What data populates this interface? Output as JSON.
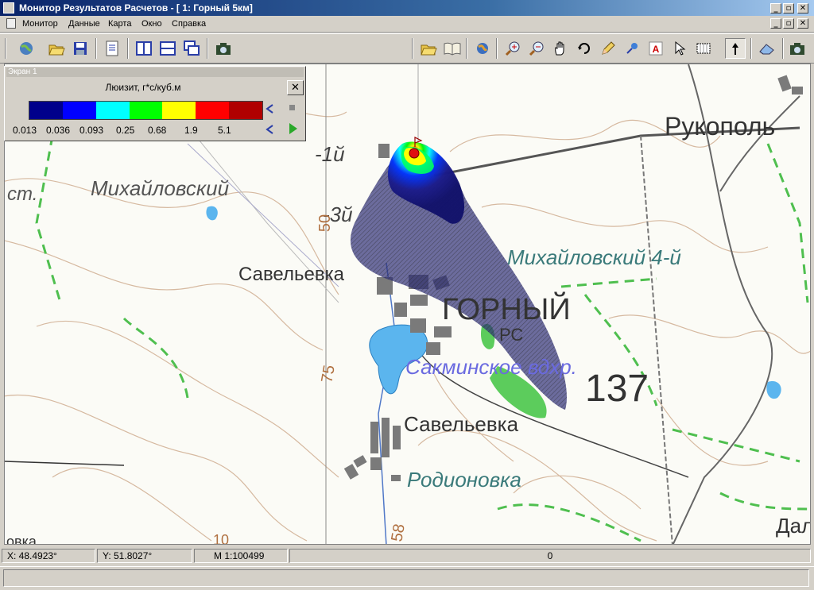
{
  "window": {
    "title": "Монитор Результатов Расчетов - [ 1: Горный 5км]"
  },
  "title_buttons": {
    "minimize": "_",
    "restore": "▫",
    "close": "✕"
  },
  "menu": {
    "items": [
      "Монитор",
      "Данные",
      "Карта",
      "Окно",
      "Справка"
    ]
  },
  "toolbar": {
    "left": [
      "globe-icon",
      "open-folder-icon",
      "save-disk-icon",
      "document-icon",
      "split-vertical-icon",
      "split-horizontal-icon",
      "cascade-windows-icon",
      "camera-icon"
    ],
    "right": [
      "open-map-icon",
      "book-icon",
      "globe-small-icon",
      "zoom-in-icon",
      "zoom-out-icon",
      "hand-pan-icon",
      "rotate-icon",
      "pencil-icon",
      "pin-icon",
      "text-tool-icon",
      "pointer-icon",
      "grid-select-icon",
      "north-arrow-icon",
      "eraser-icon",
      "camera-icon"
    ],
    "pressed": "north-arrow-icon"
  },
  "legend_panel": {
    "header": "Экран 1",
    "title": "Люизит, г*с/куб.м",
    "close": "✕",
    "colors": [
      "#00008b",
      "#0000ff",
      "#00ffff",
      "#00ff00",
      "#ffff00",
      "#ff0000",
      "#b00000"
    ],
    "values": [
      "0.013",
      "0.036",
      "0.093",
      "0.25",
      "0.68",
      "1.9",
      "5.1"
    ]
  },
  "map": {
    "labels": {
      "mikhailovsky": "Михайловский",
      "st": "ст.",
      "first": "-1й",
      "third": "-3й",
      "fifty": "50",
      "rukopol": "Рукополь",
      "savelevka_top": "Савельевка",
      "mikhailovsky4": "Михайловский 4-й",
      "gorny": "ГОРНЫЙ",
      "pc": "РС",
      "reservoir": "Сакминское вдхр.",
      "num137": "137",
      "num75": "75",
      "savelevka_bottom": "Савельевка",
      "rodionovka": "Родионовка",
      "num58": "58",
      "dal": "Дал",
      "num10": "10",
      "ovka": "овка"
    }
  },
  "status": {
    "x": "X: 48.4923°",
    "y": "Y: 51.8027°",
    "scale": "М 1:100499",
    "value": "0"
  }
}
